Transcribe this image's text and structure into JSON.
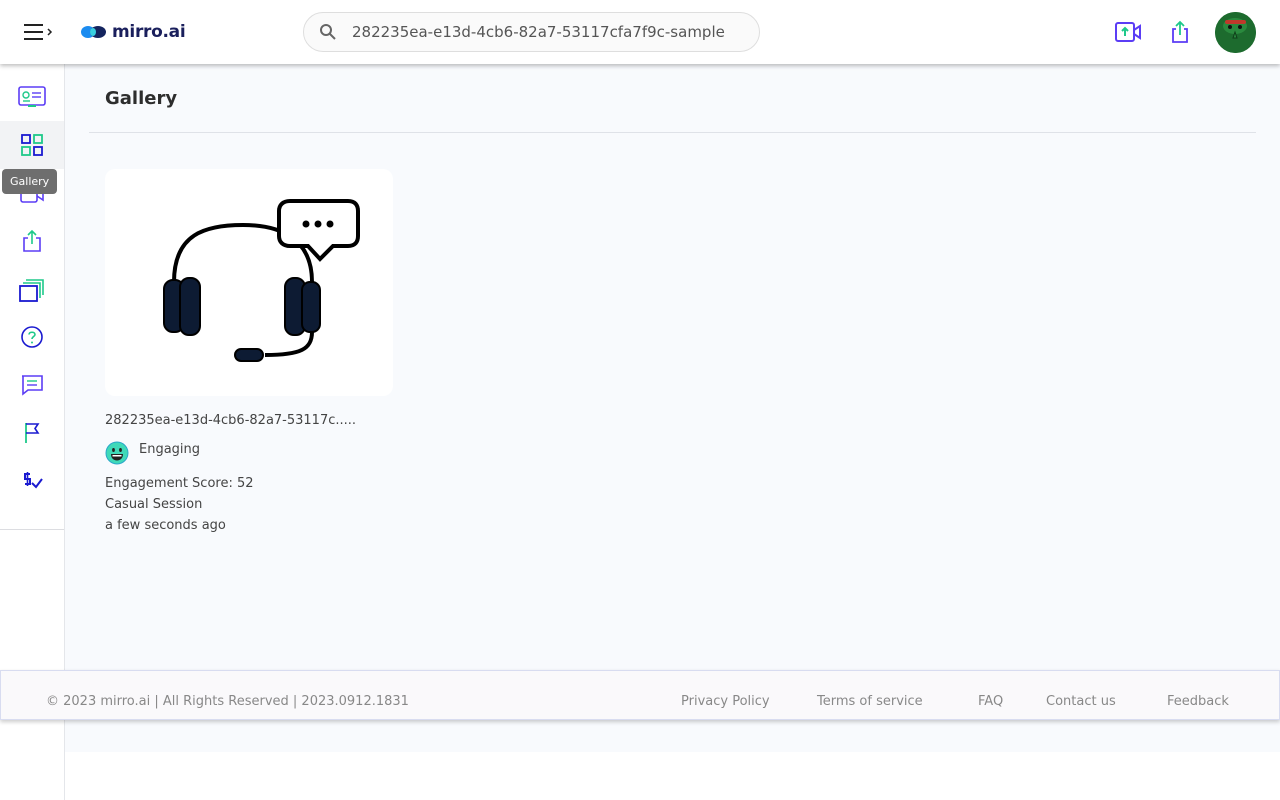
{
  "header": {
    "brand": "mirro.ai",
    "search_value": "282235ea-e13d-4cb6-82a7-53117cfa7f9c-sample",
    "icons": [
      "menu-icon",
      "record-upload-icon",
      "share-icon",
      "avatar"
    ]
  },
  "sidebar": {
    "items": [
      {
        "name": "dashboard-icon"
      },
      {
        "name": "gallery-icon",
        "active": true
      },
      {
        "name": "record-video-icon"
      },
      {
        "name": "share-upload-icon"
      },
      {
        "name": "collections-icon"
      },
      {
        "name": "help-icon"
      },
      {
        "name": "chat-icon"
      },
      {
        "name": "flag-icon"
      },
      {
        "name": "billing-icon"
      }
    ],
    "tooltip": "Gallery"
  },
  "main": {
    "title": "Gallery",
    "cards": [
      {
        "name": "282235ea-e13d-4cb6-82a7-53117c.....",
        "tag": "Engaging",
        "score": "Engagement Score: 52",
        "session": "Casual Session",
        "time": "a few seconds ago"
      }
    ]
  },
  "footer": {
    "copyright": "© 2023 mirro.ai | All Rights Reserved | 2023.0912.1831",
    "links": [
      "Privacy Policy",
      "Terms of service",
      "FAQ",
      "Contact us",
      "Feedback"
    ]
  },
  "colors": {
    "accent_purple": "#5b3df5",
    "accent_green": "#1ec98a",
    "navy": "#0d1b33"
  }
}
